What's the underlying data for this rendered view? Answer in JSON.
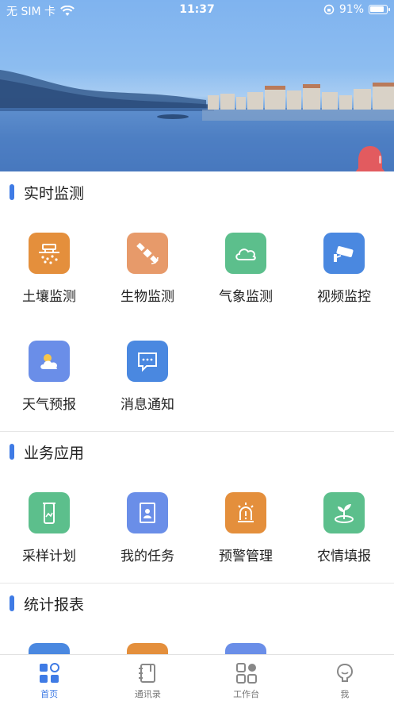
{
  "status_bar": {
    "carrier": "无 SIM 卡",
    "time": "11:37",
    "battery_percent": "91%"
  },
  "colors": {
    "accent": "#3f7be5",
    "orange": "#e48f3c",
    "salmon": "#e79a6a",
    "green": "#5cbf8c",
    "blue": "#4a88e0",
    "periwinkle": "#6a8ee8"
  },
  "sections": {
    "realtime": {
      "title": "实时监测",
      "items": [
        {
          "label": "土壤监测",
          "icon": "soil-icon"
        },
        {
          "label": "生物监测",
          "icon": "satellite-icon"
        },
        {
          "label": "气象监测",
          "icon": "cloud-icon"
        },
        {
          "label": "视频监控",
          "icon": "camera-icon"
        },
        {
          "label": "天气预报",
          "icon": "weather-icon"
        },
        {
          "label": "消息通知",
          "icon": "message-icon"
        }
      ]
    },
    "business": {
      "title": "业务应用",
      "items": [
        {
          "label": "采样计划",
          "icon": "test-tube-icon"
        },
        {
          "label": "我的任务",
          "icon": "task-icon"
        },
        {
          "label": "预警管理",
          "icon": "alarm-icon"
        },
        {
          "label": "农情填报",
          "icon": "sprout-icon"
        }
      ]
    },
    "stats": {
      "title": "统计报表"
    }
  },
  "tabbar": {
    "tabs": [
      {
        "label": "首页",
        "icon": "home-grid-icon",
        "active": true
      },
      {
        "label": "通讯录",
        "icon": "contacts-icon",
        "active": false
      },
      {
        "label": "工作台",
        "icon": "workbench-icon",
        "active": false
      },
      {
        "label": "我",
        "icon": "profile-icon",
        "active": false
      }
    ]
  }
}
